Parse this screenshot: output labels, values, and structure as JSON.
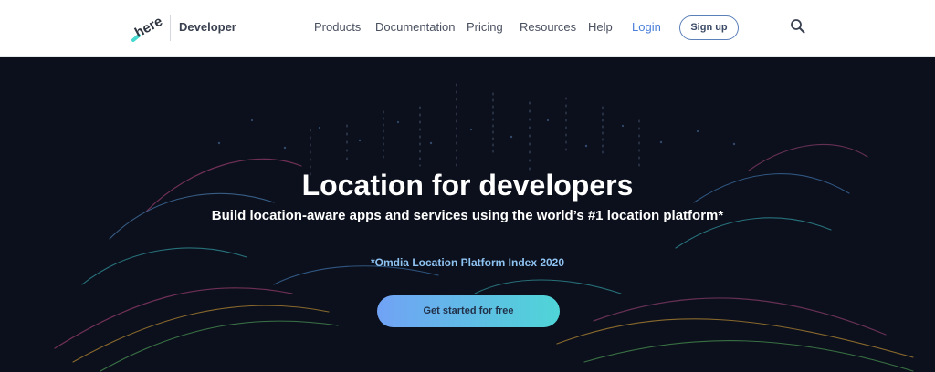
{
  "header": {
    "brand": "Developer",
    "logo_icon": "here-logo-icon",
    "nav": {
      "products": "Products",
      "documentation": "Documentation",
      "pricing": "Pricing",
      "resources": "Resources",
      "help": "Help",
      "login": "Login"
    },
    "signup_label": "Sign up",
    "search_icon": "search-icon"
  },
  "hero": {
    "title": "Location for developers",
    "subtitle": "Build location-aware apps and services using the world’s #1 location platform*",
    "footnote": "*Omdia Location Platform Index 2020",
    "cta_label": "Get started for free"
  },
  "colors": {
    "hero_bg": "#0b101c",
    "accent_login": "#4a7fd9",
    "cta_gradient_start": "#71a2f5",
    "cta_gradient_end": "#4fd5d7",
    "logo_teal": "#48dad0"
  }
}
